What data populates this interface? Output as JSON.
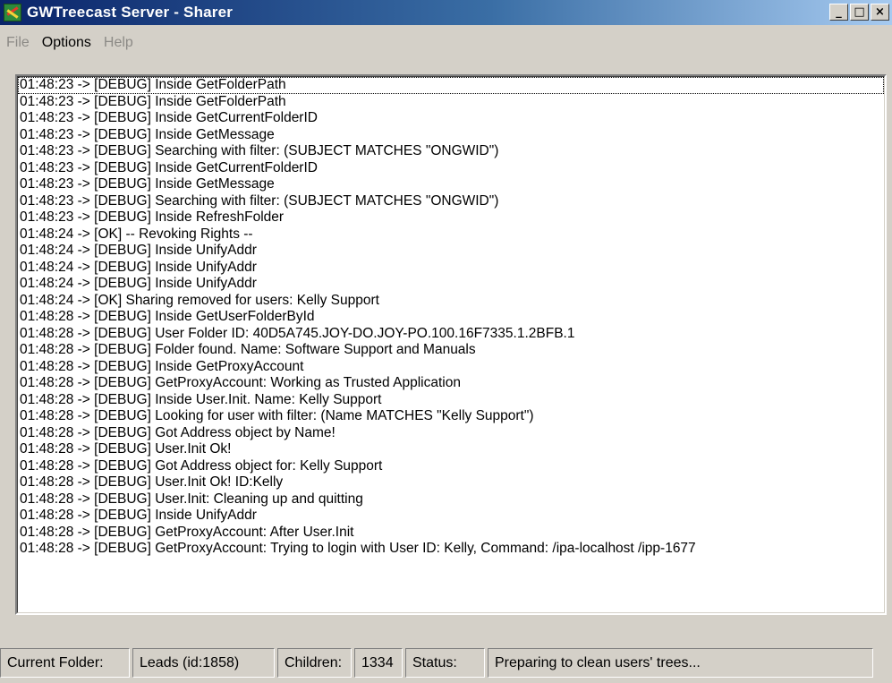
{
  "window": {
    "title": "GWTreecast Server - Sharer",
    "app_icon": "treecast-app-icon",
    "buttons": {
      "minimize": "_",
      "maximize": "□",
      "close": "×"
    }
  },
  "menu": {
    "items": [
      {
        "label": "File",
        "enabled": false
      },
      {
        "label": "Options",
        "enabled": true
      },
      {
        "label": "Help",
        "enabled": false
      }
    ]
  },
  "log": {
    "lines": [
      "01:48:23 -> [DEBUG] Inside GetFolderPath",
      "01:48:23 -> [DEBUG] Inside GetFolderPath",
      "01:48:23 -> [DEBUG] Inside GetCurrentFolderID",
      "01:48:23 -> [DEBUG] Inside GetMessage",
      "01:48:23 -> [DEBUG] Searching with filter: (SUBJECT MATCHES \"ONGWID\")",
      "01:48:23 -> [DEBUG] Inside GetCurrentFolderID",
      "01:48:23 -> [DEBUG] Inside GetMessage",
      "01:48:23 -> [DEBUG] Searching with filter: (SUBJECT MATCHES \"ONGWID\")",
      "01:48:23 -> [DEBUG] Inside RefreshFolder",
      "01:48:24 -> [OK] -- Revoking Rights --",
      "01:48:24 -> [DEBUG] Inside UnifyAddr",
      "01:48:24 -> [DEBUG] Inside UnifyAddr",
      "01:48:24 -> [DEBUG] Inside UnifyAddr",
      "01:48:24 -> [OK] Sharing removed for users: Kelly Support",
      "01:48:28 -> [DEBUG] Inside GetUserFolderById",
      "01:48:28 -> [DEBUG] User Folder ID: 40D5A745.JOY-DO.JOY-PO.100.16F7335.1.2BFB.1",
      "01:48:28 -> [DEBUG] Folder found. Name: Software Support and Manuals",
      "01:48:28 -> [DEBUG] Inside GetProxyAccount",
      "01:48:28 -> [DEBUG] GetProxyAccount: Working as Trusted Application",
      "01:48:28 -> [DEBUG] Inside User.Init. Name: Kelly Support",
      "01:48:28 -> [DEBUG] Looking for user with  filter: (Name MATCHES \"Kelly Support\")",
      "01:48:28 -> [DEBUG] Got Address object by Name!",
      "01:48:28 -> [DEBUG] User.Init Ok!",
      "01:48:28 -> [DEBUG] Got Address object for: Kelly Support",
      "01:48:28 -> [DEBUG] User.Init Ok! ID:Kelly",
      "01:48:28 -> [DEBUG] User.Init: Cleaning up and quitting",
      "01:48:28 -> [DEBUG] Inside UnifyAddr",
      "01:48:28 -> [DEBUG] GetProxyAccount: After User.Init",
      "01:48:28 -> [DEBUG] GetProxyAccount: Trying to login with User ID: Kelly, Command: /ipa-localhost /ipp-1677"
    ]
  },
  "status": {
    "current_folder_label": "Current Folder:",
    "current_folder_value": "Leads (id:1858)",
    "children_label": "Children:",
    "children_value": "1334",
    "status_label": "Status:",
    "status_value": "Preparing to clean users' trees..."
  }
}
